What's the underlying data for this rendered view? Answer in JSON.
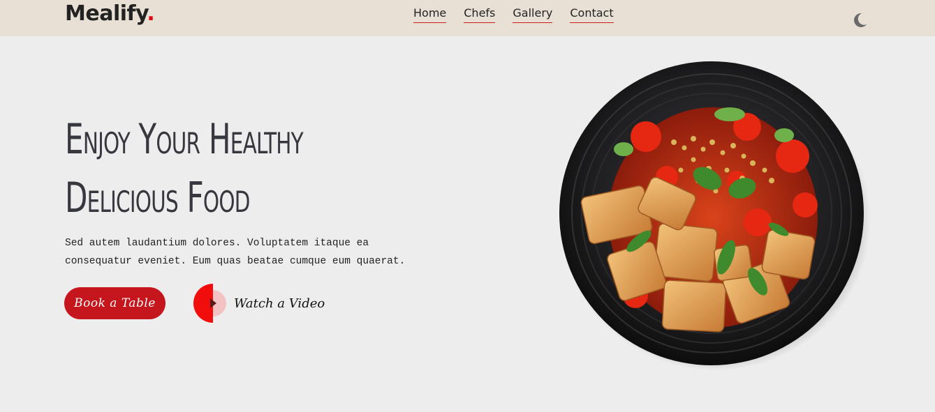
{
  "brand": {
    "name": "Mealify",
    "dot": ".",
    "accent_color": "#e30613"
  },
  "nav": {
    "links": [
      "Home",
      "Chefs",
      "Gallery",
      "Contact"
    ],
    "theme_icon": "moon-icon"
  },
  "hero": {
    "title_line1": "Enjoy Your Healthy",
    "title_line2": "Delicious Food",
    "description_line1": "Sed autem laudantium dolores. Voluptatem itaque ea",
    "description_line2": "consequatur eveniet. Eum quas beatae cumque eum quaerat.",
    "primary_button": "Book a Table",
    "video_button": "Watch a Video",
    "button_color": "#c4161c",
    "image": "food-bowl-image"
  }
}
